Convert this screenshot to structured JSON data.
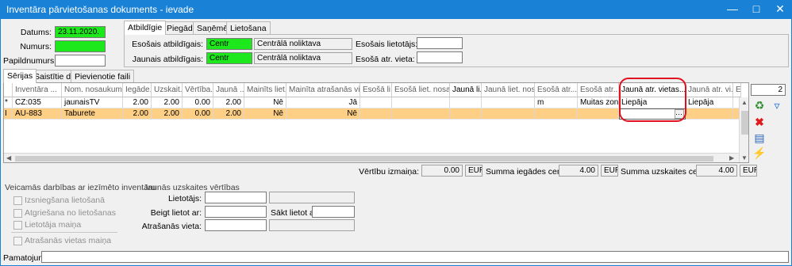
{
  "window": {
    "title": "Inventāra pārvietošanas dokuments - ievade"
  },
  "header": {
    "datums_label": "Datums:",
    "datums_value": "23.11.2020.",
    "numurs_label": "Numurs:",
    "numurs_value": "",
    "papildnumurs_label": "Papildnumurs:",
    "papildnumurs_value": ""
  },
  "top_tabs": [
    "Atbildīgie",
    "Piegāde",
    "Saņēmējs",
    "Lietošana"
  ],
  "atbildigie": {
    "esosais_label": "Esošais atbildīgais:",
    "esosais_code": "Centr",
    "esosais_name": "Centrālā noliktava",
    "jaunais_label": "Jaunais atbildīgais:",
    "jaunais_code": "Centr",
    "jaunais_name": "Centrālā noliktava",
    "esosais_lietotajs_label": "Esošais lietotājs:",
    "esosais_lietotajs_value": "",
    "esosa_vieta_label": "Esošā atr. vieta:",
    "esosa_vieta_value": ""
  },
  "section_tabs": [
    "Sērijas",
    "Saistītie dati",
    "Pievienotie faili"
  ],
  "grid": {
    "columns": [
      "Inventāra ...",
      "Nom. nosaukums",
      "Iegāde...",
      "Uzskait...",
      "Vērtība...",
      "Jaunā ...",
      "Mainīts liet...",
      "Mainīta atrašanās vieta",
      "Esošā li...",
      "Esošā liet. nosa...",
      "Jaunā li...",
      "Jaunā liet. nosa...",
      "Esošā atr...",
      "Esošā atr...",
      "Jaunā atr. vietas...",
      "Jaunā atr. vi...",
      "E"
    ],
    "rows": [
      {
        "marker": "*",
        "cells": [
          "CZ:035",
          "jaunaisTV",
          "2.00",
          "2.00",
          "0.00",
          "2.00",
          "Nē",
          "Jā",
          "",
          "",
          "",
          "",
          "m",
          "Muitas zona",
          "Liepāja",
          "Liepāja",
          ""
        ]
      },
      {
        "marker": "I",
        "cells": [
          "AU-883",
          "Taburete",
          "2.00",
          "2.00",
          "0.00",
          "2.00",
          "Nē",
          "Nē",
          "",
          "",
          "",
          "",
          "",
          "",
          "",
          "",
          ""
        ]
      }
    ]
  },
  "side_toolbar": {
    "count": "2"
  },
  "totals": {
    "vertibu_label": "Vērtību izmaiņa:",
    "vertibu_value": "0.00",
    "vertibu_cur": "EUR",
    "iegades_label": "Summa iegādes cenās:",
    "iegades_value": "4.00",
    "iegades_cur": "EUR",
    "uzskaites_label": "Summa uzskaites cenās:",
    "uzskaites_value": "4.00",
    "uzskaites_cur": "EUR"
  },
  "actions": {
    "group_title": "Veicamās darbības ar iezīmēto inventāru",
    "items": [
      "Izsniegšana lietošanā",
      "Atgriešana no lietošanas",
      "Lietotāja maiņa",
      "Atrašanās vietas maiņa"
    ]
  },
  "new_values": {
    "group_title": "Jaunās uzskaites vērtības",
    "lietotajs_label": "Lietotājs:",
    "lietotajs_value": "",
    "beigt_label": "Beigt lietot ar:",
    "beigt_value": "",
    "sakt_label": "Sākt lietot ar:",
    "sakt_value": "",
    "vieta_label": "Atrašanās vieta:",
    "vieta_value": ""
  },
  "footer": {
    "pamatojums_label": "Pamatojums:",
    "pamatojums_value": ""
  },
  "colors": {
    "title_bar": "#1a82d6",
    "required_field": "#1ce81c",
    "selected_row": "#ffcf85",
    "highlight_circle": "#e0101e"
  },
  "icons": [
    "minimize-icon",
    "maximize-icon",
    "close-icon",
    "add-record-icon",
    "filter-icon",
    "delete-icon",
    "export-icon",
    "lightning-icon",
    "ellipsis-icon"
  ]
}
